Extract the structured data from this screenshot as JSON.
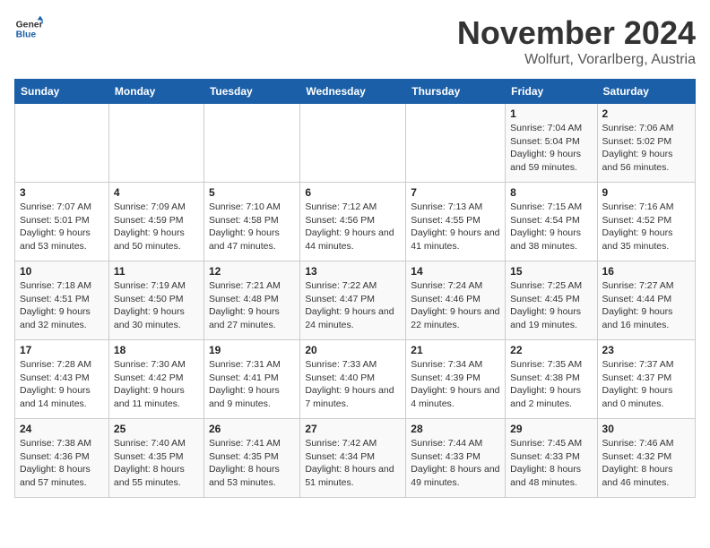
{
  "logo": {
    "line1": "General",
    "line2": "Blue"
  },
  "title": "November 2024",
  "subtitle": "Wolfurt, Vorarlberg, Austria",
  "weekdays": [
    "Sunday",
    "Monday",
    "Tuesday",
    "Wednesday",
    "Thursday",
    "Friday",
    "Saturday"
  ],
  "weeks": [
    [
      {
        "day": "",
        "info": ""
      },
      {
        "day": "",
        "info": ""
      },
      {
        "day": "",
        "info": ""
      },
      {
        "day": "",
        "info": ""
      },
      {
        "day": "",
        "info": ""
      },
      {
        "day": "1",
        "info": "Sunrise: 7:04 AM\nSunset: 5:04 PM\nDaylight: 9 hours and 59 minutes."
      },
      {
        "day": "2",
        "info": "Sunrise: 7:06 AM\nSunset: 5:02 PM\nDaylight: 9 hours and 56 minutes."
      }
    ],
    [
      {
        "day": "3",
        "info": "Sunrise: 7:07 AM\nSunset: 5:01 PM\nDaylight: 9 hours and 53 minutes."
      },
      {
        "day": "4",
        "info": "Sunrise: 7:09 AM\nSunset: 4:59 PM\nDaylight: 9 hours and 50 minutes."
      },
      {
        "day": "5",
        "info": "Sunrise: 7:10 AM\nSunset: 4:58 PM\nDaylight: 9 hours and 47 minutes."
      },
      {
        "day": "6",
        "info": "Sunrise: 7:12 AM\nSunset: 4:56 PM\nDaylight: 9 hours and 44 minutes."
      },
      {
        "day": "7",
        "info": "Sunrise: 7:13 AM\nSunset: 4:55 PM\nDaylight: 9 hours and 41 minutes."
      },
      {
        "day": "8",
        "info": "Sunrise: 7:15 AM\nSunset: 4:54 PM\nDaylight: 9 hours and 38 minutes."
      },
      {
        "day": "9",
        "info": "Sunrise: 7:16 AM\nSunset: 4:52 PM\nDaylight: 9 hours and 35 minutes."
      }
    ],
    [
      {
        "day": "10",
        "info": "Sunrise: 7:18 AM\nSunset: 4:51 PM\nDaylight: 9 hours and 32 minutes."
      },
      {
        "day": "11",
        "info": "Sunrise: 7:19 AM\nSunset: 4:50 PM\nDaylight: 9 hours and 30 minutes."
      },
      {
        "day": "12",
        "info": "Sunrise: 7:21 AM\nSunset: 4:48 PM\nDaylight: 9 hours and 27 minutes."
      },
      {
        "day": "13",
        "info": "Sunrise: 7:22 AM\nSunset: 4:47 PM\nDaylight: 9 hours and 24 minutes."
      },
      {
        "day": "14",
        "info": "Sunrise: 7:24 AM\nSunset: 4:46 PM\nDaylight: 9 hours and 22 minutes."
      },
      {
        "day": "15",
        "info": "Sunrise: 7:25 AM\nSunset: 4:45 PM\nDaylight: 9 hours and 19 minutes."
      },
      {
        "day": "16",
        "info": "Sunrise: 7:27 AM\nSunset: 4:44 PM\nDaylight: 9 hours and 16 minutes."
      }
    ],
    [
      {
        "day": "17",
        "info": "Sunrise: 7:28 AM\nSunset: 4:43 PM\nDaylight: 9 hours and 14 minutes."
      },
      {
        "day": "18",
        "info": "Sunrise: 7:30 AM\nSunset: 4:42 PM\nDaylight: 9 hours and 11 minutes."
      },
      {
        "day": "19",
        "info": "Sunrise: 7:31 AM\nSunset: 4:41 PM\nDaylight: 9 hours and 9 minutes."
      },
      {
        "day": "20",
        "info": "Sunrise: 7:33 AM\nSunset: 4:40 PM\nDaylight: 9 hours and 7 minutes."
      },
      {
        "day": "21",
        "info": "Sunrise: 7:34 AM\nSunset: 4:39 PM\nDaylight: 9 hours and 4 minutes."
      },
      {
        "day": "22",
        "info": "Sunrise: 7:35 AM\nSunset: 4:38 PM\nDaylight: 9 hours and 2 minutes."
      },
      {
        "day": "23",
        "info": "Sunrise: 7:37 AM\nSunset: 4:37 PM\nDaylight: 9 hours and 0 minutes."
      }
    ],
    [
      {
        "day": "24",
        "info": "Sunrise: 7:38 AM\nSunset: 4:36 PM\nDaylight: 8 hours and 57 minutes."
      },
      {
        "day": "25",
        "info": "Sunrise: 7:40 AM\nSunset: 4:35 PM\nDaylight: 8 hours and 55 minutes."
      },
      {
        "day": "26",
        "info": "Sunrise: 7:41 AM\nSunset: 4:35 PM\nDaylight: 8 hours and 53 minutes."
      },
      {
        "day": "27",
        "info": "Sunrise: 7:42 AM\nSunset: 4:34 PM\nDaylight: 8 hours and 51 minutes."
      },
      {
        "day": "28",
        "info": "Sunrise: 7:44 AM\nSunset: 4:33 PM\nDaylight: 8 hours and 49 minutes."
      },
      {
        "day": "29",
        "info": "Sunrise: 7:45 AM\nSunset: 4:33 PM\nDaylight: 8 hours and 48 minutes."
      },
      {
        "day": "30",
        "info": "Sunrise: 7:46 AM\nSunset: 4:32 PM\nDaylight: 8 hours and 46 minutes."
      }
    ]
  ]
}
